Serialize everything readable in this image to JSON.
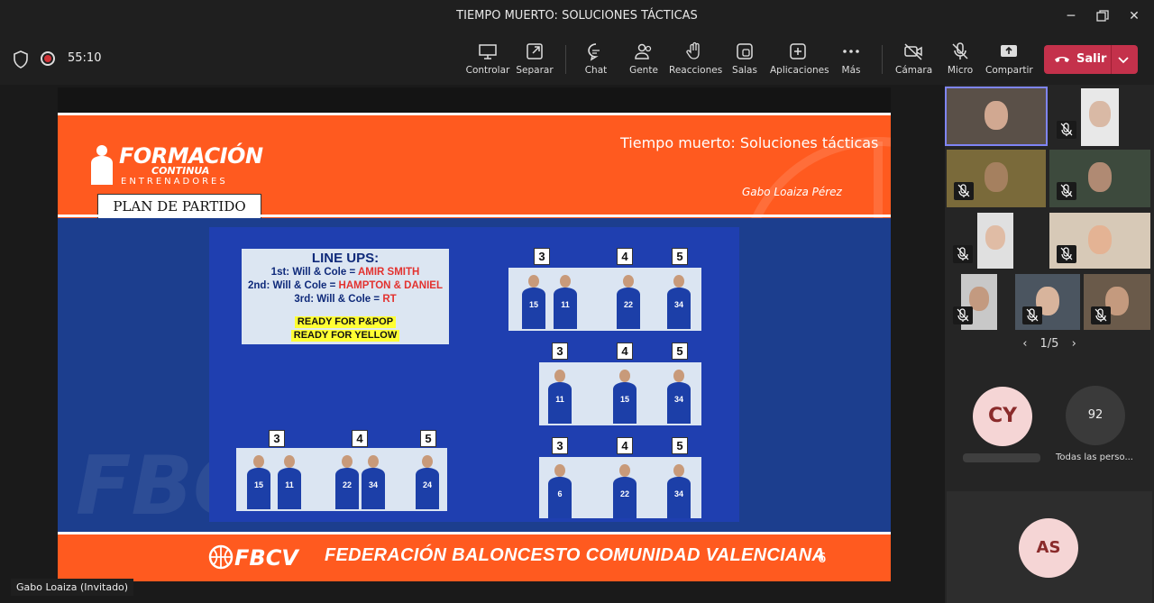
{
  "window": {
    "title": "TIEMPO MUERTO: SOLUCIONES TÁCTICAS"
  },
  "toolbar": {
    "timer": "55:10",
    "buttons": [
      {
        "id": "controlar",
        "label": "Controlar"
      },
      {
        "id": "separar",
        "label": "Separar"
      },
      {
        "id": "chat",
        "label": "Chat"
      },
      {
        "id": "gente",
        "label": "Gente"
      },
      {
        "id": "reacciones",
        "label": "Reacciones"
      },
      {
        "id": "salas",
        "label": "Salas"
      },
      {
        "id": "aplicaciones",
        "label": "Aplicaciones"
      },
      {
        "id": "mas",
        "label": "Más"
      },
      {
        "id": "camara",
        "label": "Cámara"
      },
      {
        "id": "microfono",
        "label": "Micro"
      },
      {
        "id": "compartir",
        "label": "Compartir"
      }
    ],
    "leave_label": "Salir",
    "colors": {
      "leave": "#c4314b",
      "record": "#d13438"
    }
  },
  "slide": {
    "brand": {
      "line1": "FORMACIÓN",
      "line2": "CONTINUA",
      "line3": "ENTRENADORES"
    },
    "plan_label": "PLAN DE PARTIDO",
    "title": "Tiempo muerto: Soluciones tácticas",
    "author": "Gabo Loaiza Pérez",
    "lineups": {
      "heading": "LINE UPS:",
      "rows": [
        {
          "prefix": "1st: Will & Cole = ",
          "name": "AMIR SMITH"
        },
        {
          "prefix": "2nd: Will & Cole = ",
          "name": "HAMPTON & DANIEL"
        },
        {
          "prefix": "3rd: Will & Cole = ",
          "name": "RT"
        }
      ],
      "notes": [
        "READY FOR P&POP",
        "READY FOR YELLOW"
      ]
    },
    "position_labels": [
      "3",
      "4",
      "5"
    ],
    "footer_logo": "FBCV",
    "footer_text": "FEDERACIÓN BALONCESTO COMUNIDAD VALENCIANA",
    "page_number": "6",
    "watermark": "FBC",
    "colors": {
      "orange": "#ff5a1f",
      "navy": "#1c3e8e",
      "board": "#1f3fb0",
      "highlight": "#ffff33",
      "red": "#e3322f"
    }
  },
  "presenter_label": "Gabo Loaiza (Invitado)",
  "panel": {
    "pager": "1/5",
    "avatars": [
      {
        "initials": "CY",
        "name": ""
      },
      {
        "initials": "92",
        "name": "Todas las perso..."
      },
      {
        "initials": "AS",
        "name": ""
      }
    ]
  }
}
